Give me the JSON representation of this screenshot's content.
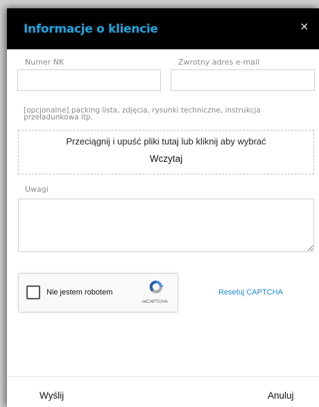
{
  "dialog": {
    "title": "Informacje o kliencie",
    "close_glyph": "×"
  },
  "form": {
    "nk_label": "Numer NK",
    "nk_value": "",
    "email_label": "Zwrotny adres e-mail",
    "email_value": "",
    "attachments_hint": "[opcjonalne] packing lista, zdjęcia, rysunki techniczne, instrukcja przeładunkowa itp.",
    "dropzone_text": "Przeciągnij i upuść pliki tutaj lub kliknij aby wybrać",
    "upload_button": "Wczytaj",
    "notes_label": "Uwagi",
    "notes_value": ""
  },
  "captcha": {
    "label": "Nie jestem robotem",
    "brand": "reCAPTCHA",
    "reset_link": "Resetuj CAPTCHA",
    "checked": false
  },
  "footer": {
    "send_button": "Wyślij",
    "cancel_button": "Anuluj"
  },
  "colors": {
    "title": "#1ea6e0",
    "header_bg": "#000000",
    "link": "#1f86cf"
  }
}
